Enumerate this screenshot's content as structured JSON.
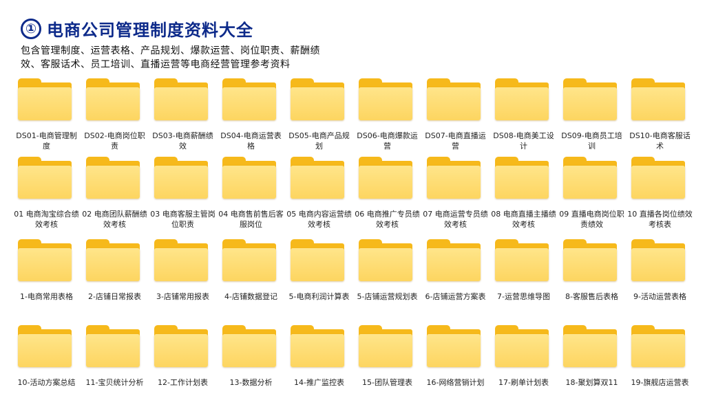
{
  "header": {
    "badge": "①",
    "title": "电商公司管理制度资料大全",
    "subtitle": "包含管理制度、运营表格、产品规划、爆款运营、岗位职责、薪酬绩效、客服话术、员工培训、直播运营等电商经营管理参考资料"
  },
  "colors": {
    "title": "#0d2a8a",
    "folder_front": "#fdd560",
    "folder_back": "#f6b91b"
  },
  "rows": [
    [
      "DS01-电商管理制度",
      "DS02-电商岗位职责",
      "DS03-电商薪酬绩效",
      "DS04-电商运营表格",
      "DS05-电商产品规划",
      "DS06-电商爆款运营",
      "DS07-电商直播运营",
      "DS08-电商美工设计",
      "DS09-电商员工培训",
      "DS10-电商客服话术"
    ],
    [
      "01 电商淘宝综合绩效考核",
      "02 电商团队薪酬绩效考核",
      "03 电商客服主管岗位职责",
      "04 电商售前售后客服岗位",
      "05 电商内容运营绩效考核",
      "06 电商推广专员绩效考核",
      "07 电商运营专员绩效考核",
      "08 电商直播主播绩效考核",
      "09 直播电商岗位职责绩效",
      "10 直播各岗位绩效考核表"
    ],
    [
      "1-电商常用表格",
      "2-店铺日常报表",
      "3-店铺常用报表",
      "4-店铺数据登记",
      "5-电商利润计算表",
      "5-店铺运营规划表",
      "6-店铺运营方案表",
      "7-运营思维导图",
      "8-客服售后表格",
      "9-活动运营表格"
    ],
    [
      "10-活动方案总结",
      "11-宝贝统计分析",
      "12-工作计划表",
      "13-数据分析",
      "14-推广监控表",
      "15-团队管理表",
      "16-网络营销计划",
      "17-刷单计划表",
      "18-聚划算双11",
      "19-旗舰店运营表"
    ]
  ],
  "icon": "folder-icon"
}
